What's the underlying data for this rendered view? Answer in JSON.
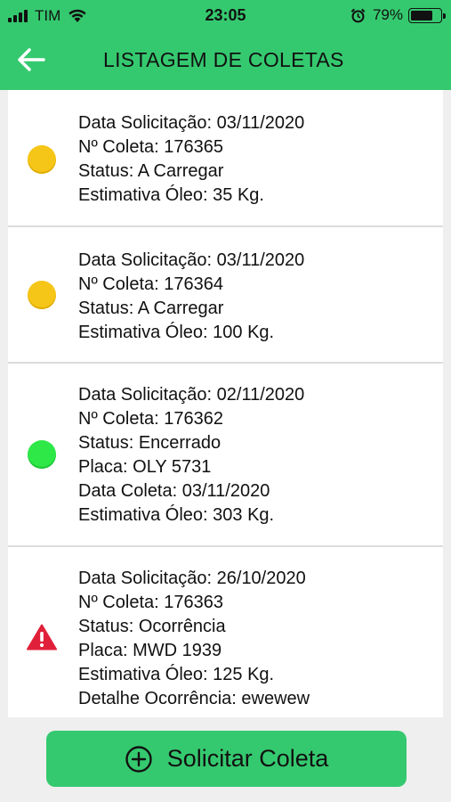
{
  "status_bar": {
    "carrier": "TIM",
    "time": "23:05",
    "battery_percent": "79%",
    "battery_level": 0.79
  },
  "header": {
    "title": "LISTAGEM DE COLETAS",
    "back_icon": "arrow-left-icon"
  },
  "colors": {
    "brand_green": "#35c96f",
    "status_pending": "#f5c518",
    "status_closed": "#2ee848",
    "status_occurrence": "#e0203a"
  },
  "coletas": [
    {
      "status_icon": "yellow-dot",
      "lines": [
        "Data Solicitação: 03/11/2020",
        "Nº Coleta: 176365",
        "Status: A Carregar",
        "Estimativa Óleo: 35 Kg."
      ]
    },
    {
      "status_icon": "yellow-dot",
      "lines": [
        "Data Solicitação: 03/11/2020",
        "Nº Coleta: 176364",
        "Status: A Carregar",
        "Estimativa Óleo: 100 Kg."
      ]
    },
    {
      "status_icon": "green-dot",
      "lines": [
        "Data Solicitação: 02/11/2020",
        "Nº Coleta: 176362",
        "Status: Encerrado",
        "Placa: OLY 5731",
        "Data Coleta: 03/11/2020",
        "Estimativa Óleo: 303 Kg."
      ]
    },
    {
      "status_icon": "warning-icon",
      "lines": [
        "Data Solicitação: 26/10/2020",
        "Nº Coleta: 176363",
        "Status: Ocorrência",
        "Placa: MWD 1939",
        "Estimativa Óleo: 125 Kg.",
        "Detalhe Ocorrência: ewewew"
      ]
    }
  ],
  "footer": {
    "button_label": "Solicitar Coleta",
    "button_icon": "plus-circle-icon"
  }
}
